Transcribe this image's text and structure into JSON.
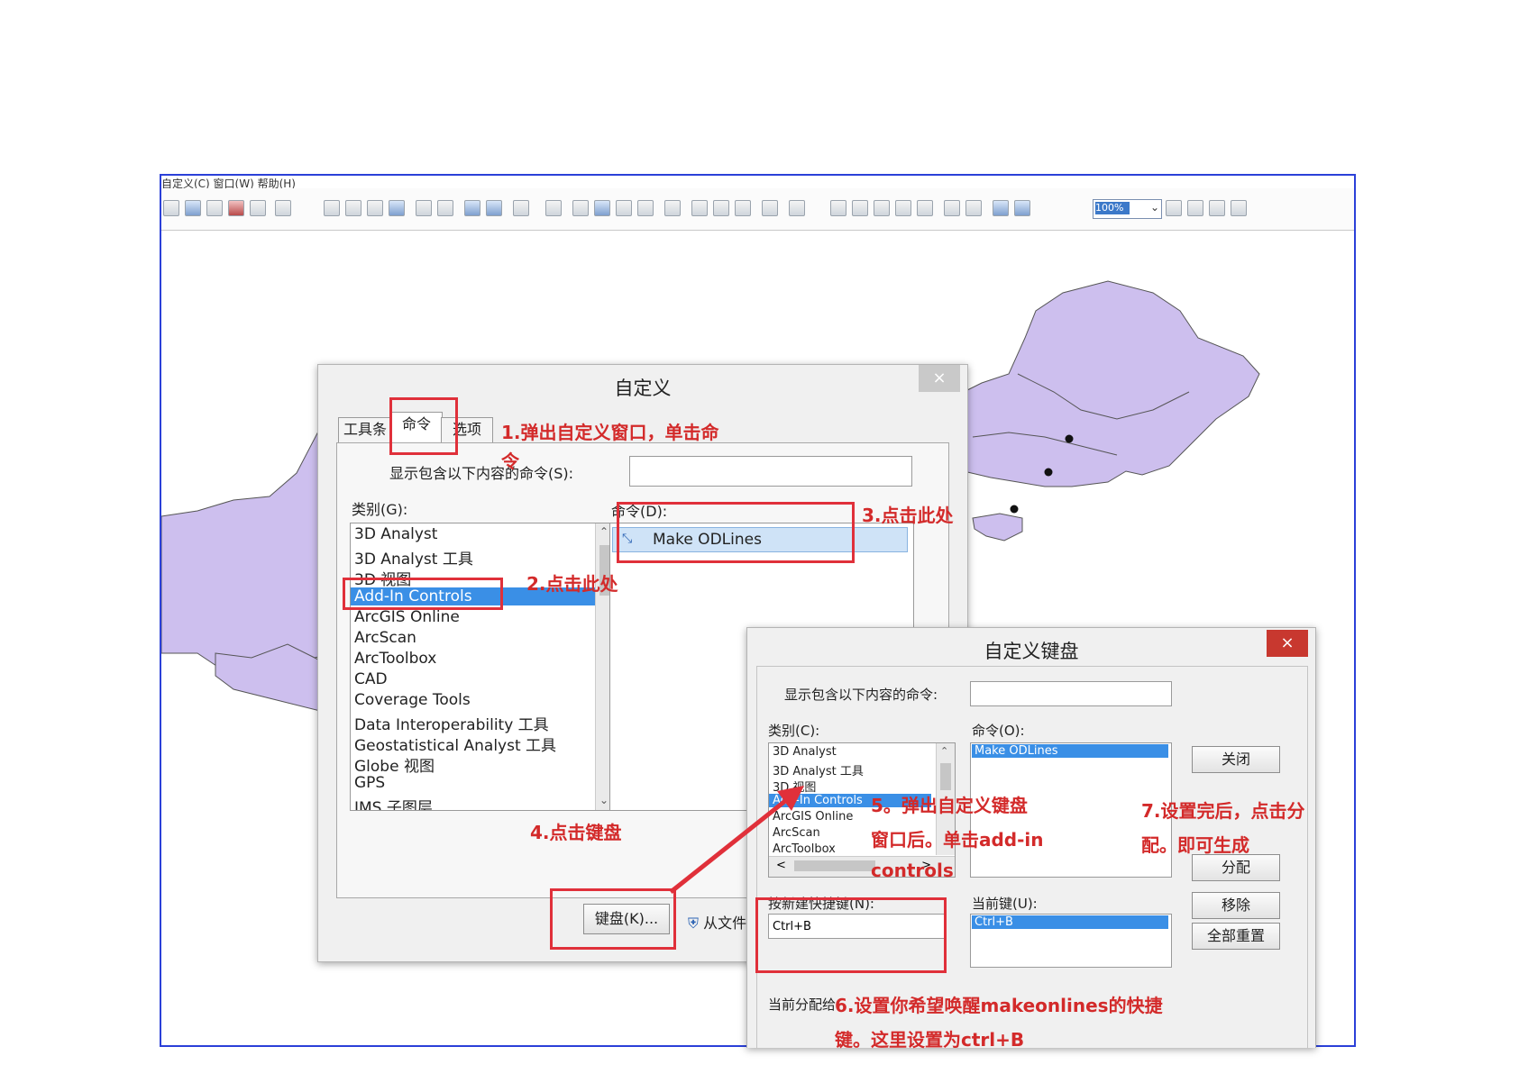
{
  "app": {
    "menubar": "自定义(C)  窗口(W)  帮助(H)",
    "zoom_level": "100%"
  },
  "customize_dialog": {
    "title": "自定义",
    "close": "×",
    "tabs": [
      "工具条",
      "命令",
      "选项"
    ],
    "search_label": "显示包含以下内容的命令(S):",
    "search_value": "",
    "categories_label": "类别(G):",
    "categories": [
      "3D Analyst",
      "3D Analyst 工具",
      "3D 视图",
      "Add-In Controls",
      "ArcGIS Online",
      "ArcScan",
      "ArcToolbox",
      "CAD",
      "Coverage Tools",
      "Data Interoperability 工具",
      "Geostatistical Analyst 工具",
      "Globe 视图",
      "GPS",
      "IMS 子图层"
    ],
    "selected_category": "Add-In Controls",
    "commands_label": "命令(D):",
    "commands": [
      "Make ODLines"
    ],
    "keyboard_button": "键盘(K)...",
    "from_file_button": "从文件"
  },
  "keyboard_dialog": {
    "title": "自定义键盘",
    "close": "×",
    "search_label": "显示包含以下内容的命令:",
    "categories_label": "类别(C):",
    "categories": [
      "3D Analyst",
      "3D Analyst 工具",
      "3D 视图",
      "Add-In Controls",
      "ArcGIS Online",
      "ArcScan",
      "ArcToolbox"
    ],
    "selected_category": "Add-In Controls",
    "commands_label": "命令(O):",
    "commands": [
      "Make ODLines"
    ],
    "new_shortcut_label": "按新建快捷键(N):",
    "new_shortcut_value": "Ctrl+B",
    "current_keys_label": "当前键(U):",
    "current_keys": [
      "Ctrl+B"
    ],
    "current_assign_label": "当前分配给:",
    "buttons": {
      "close": "关闭",
      "assign": "分配",
      "remove": "移除",
      "reset_all": "全部重置"
    }
  },
  "annotations": {
    "a1": "1.弹出自定义窗口，单击命",
    "a1b": "令",
    "a2": "2.点击此处",
    "a3": "3.点击此处",
    "a4": "4.点击键盘",
    "a5a": "5。弹出自定义键盘",
    "a5b": "窗口后。单击add-in",
    "a5c": "controls",
    "a6a": "6.设置你希望唤醒makeonlines的快捷",
    "a6b": "键。这里设置为ctrl+B",
    "a7a": "7.设置完后，点击分",
    "a7b": "配。即可生成"
  },
  "colors": {
    "annotation": "#d32a2a",
    "map_fill": "#cdbfee",
    "frame": "#2b40d8",
    "selection": "#3a8fe6"
  }
}
